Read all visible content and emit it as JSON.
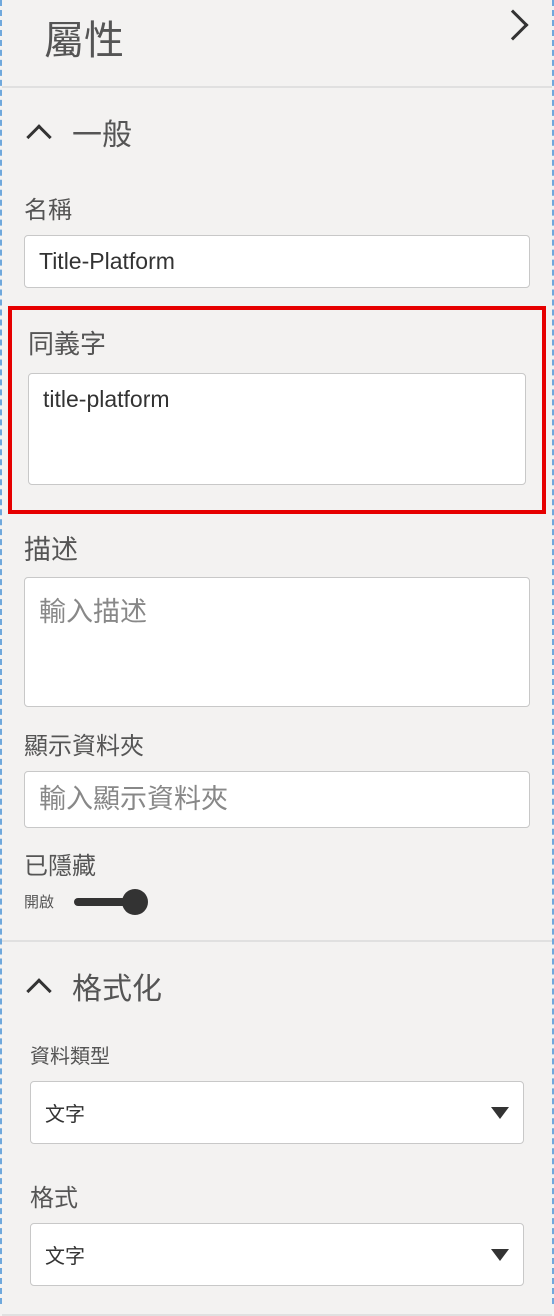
{
  "header": {
    "title": "屬性"
  },
  "sections": {
    "general": {
      "title": "一般",
      "name": {
        "label": "名稱",
        "value": "Title-Platform"
      },
      "synonym": {
        "label": "同義字",
        "value": "title-platform"
      },
      "description": {
        "label": "描述",
        "placeholder": "輸入描述"
      },
      "displayFolder": {
        "label": "顯示資料夾",
        "placeholder": "輸入顯示資料夾"
      },
      "hidden": {
        "label": "已隱藏",
        "stateLabel": "開啟"
      }
    },
    "formatting": {
      "title": "格式化",
      "dataType": {
        "label": "資料類型",
        "value": "文字"
      },
      "format": {
        "label": "格式",
        "value": "文字"
      }
    }
  }
}
